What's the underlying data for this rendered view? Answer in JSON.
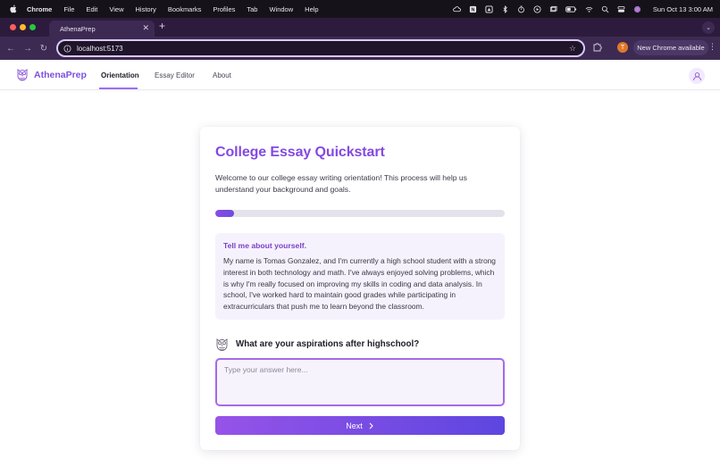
{
  "menubar": {
    "app": "Chrome",
    "items": [
      "File",
      "Edit",
      "View",
      "History",
      "Bookmarks",
      "Profiles",
      "Tab",
      "Window",
      "Help"
    ],
    "clock": "Sun Oct 13  3:00 AM"
  },
  "browser": {
    "tab_title": "AthenaPrep",
    "url": "localhost:5173",
    "profile_initial": "T",
    "update_label": "New Chrome available"
  },
  "app": {
    "brand": "AthenaPrep",
    "nav": [
      {
        "label": "Orientation",
        "active": true
      },
      {
        "label": "Essay Editor",
        "active": false
      },
      {
        "label": "About",
        "active": false
      }
    ]
  },
  "card": {
    "title": "College Essay Quickstart",
    "intro": "Welcome to our college essay writing orientation! This process will help us understand your background and goals.",
    "progress": 0.065,
    "previous_question": "Tell me about yourself.",
    "previous_answer": "My name is Tomas Gonzalez, and I'm currently a high school student with a strong interest in both technology and math. I've always enjoyed solving problems, which is why I'm really focused on improving my skills in coding and data analysis. In school, I've worked hard to maintain good grades while participating in extracurriculars that push me to learn beyond the classroom.",
    "current_question": "What are your aspirations after highschool?",
    "input_placeholder": "Type your answer here...",
    "next_label": "Next"
  },
  "colors": {
    "accent": "#8449e2",
    "button_gradient_start": "#9653e8",
    "button_gradient_end": "#5d46e0"
  }
}
